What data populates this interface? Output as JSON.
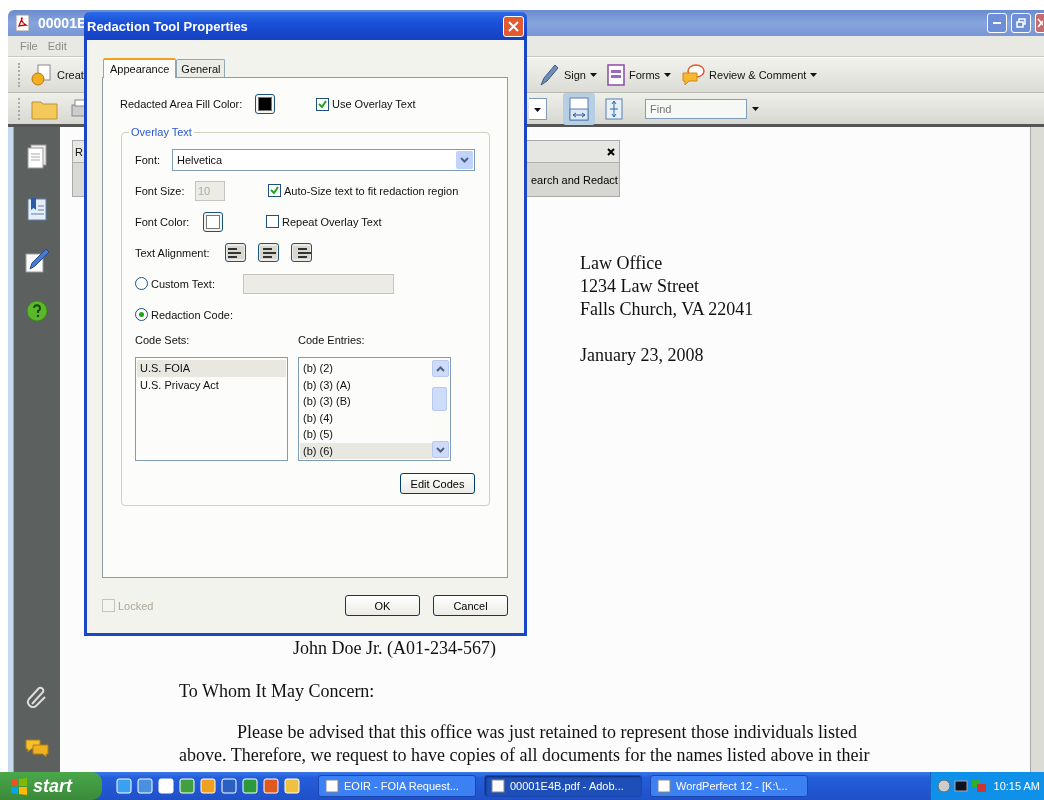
{
  "window": {
    "title": "00001E"
  },
  "menu": [
    "File",
    "Edit"
  ],
  "toolbar": [
    {
      "kind": "create",
      "label": "Creat"
    },
    {
      "kind": "sign",
      "label": "Sign"
    },
    {
      "kind": "forms",
      "label": "Forms"
    },
    {
      "kind": "review",
      "label": "Review & Comment"
    }
  ],
  "view_toolbar": {
    "fit_width_selected": true,
    "find": {
      "placeholder": "Find"
    }
  },
  "redact_panel": {
    "title": "R",
    "button": "earch and Redact"
  },
  "document": {
    "address": [
      "Law Office",
      "1234 Law Street",
      "Falls Church, VA 22041"
    ],
    "date": "January 23, 2008",
    "names": [
      "John Doe Jr. (A01-234-567)"
    ],
    "salutation": "To Whom It May Concern:",
    "body": [
      "Please be advised that this office was just retained to represent those individuals listed",
      "above.  Therefore, we request to have copies of all documents for the names listed above in their"
    ]
  },
  "dialog": {
    "title": "Redaction Tool Properties",
    "tabs": [
      {
        "label": "Appearance",
        "selected": true
      },
      {
        "label": "General",
        "selected": false
      }
    ],
    "fill_color_label": "Redacted Area Fill Color:",
    "use_overlay": {
      "label": "Use Overlay Text",
      "checked": true
    },
    "group_title": "Overlay Text",
    "font": {
      "label": "Font:",
      "value": "Helvetica"
    },
    "font_size": {
      "label": "Font Size:",
      "value": "10",
      "disabled": true
    },
    "auto_size": {
      "label": "Auto-Size text to fit redaction region",
      "checked": true
    },
    "font_color_label": "Font Color:",
    "repeat": {
      "label": "Repeat Overlay Text",
      "checked": false
    },
    "alignment_label": "Text Alignment:",
    "custom_text": {
      "label": "Custom Text:",
      "selected": false
    },
    "redaction_code": {
      "label": "Redaction Code:",
      "selected": true
    },
    "code_sets": {
      "label": "Code Sets:",
      "items": [
        {
          "text": "U.S. FOIA",
          "selected": true
        },
        {
          "text": "U.S. Privacy Act",
          "selected": false
        }
      ]
    },
    "code_entries": {
      "label": "Code Entries:",
      "items": [
        {
          "text": "(b) (2)",
          "selected": false
        },
        {
          "text": "(b) (3) (A)",
          "selected": false
        },
        {
          "text": "(b) (3) (B)",
          "selected": false
        },
        {
          "text": "(b) (4)",
          "selected": false
        },
        {
          "text": "(b) (5)",
          "selected": false
        },
        {
          "text": "(b) (6)",
          "selected": true
        }
      ]
    },
    "edit_codes": "Edit Codes",
    "locked": {
      "label": "Locked",
      "checked": false,
      "disabled": true
    },
    "buttons": [
      "OK",
      "Cancel"
    ]
  },
  "taskbar": {
    "start": "start",
    "tasks": [
      {
        "label": "EOIR - FOIA Request...",
        "selected": false
      },
      {
        "label": "00001E4B.pdf - Adob...",
        "selected": true
      },
      {
        "label": "WordPerfect 12 - [K:\\...",
        "selected": false
      }
    ],
    "clock": "10:15 AM"
  }
}
